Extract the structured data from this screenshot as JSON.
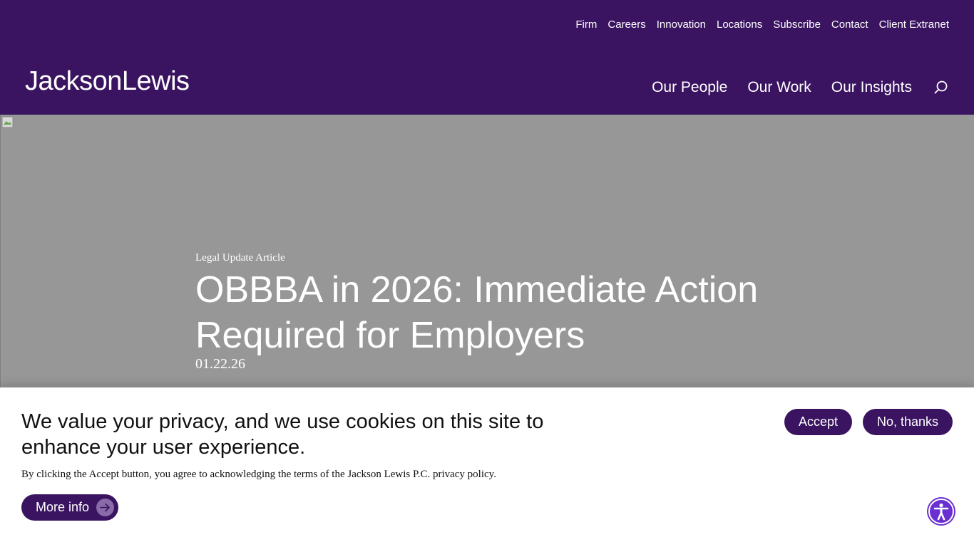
{
  "util_nav": [
    "Firm",
    "Careers",
    "Innovation",
    "Locations",
    "Subscribe",
    "Contact",
    "Client Extranet"
  ],
  "logo": "JacksonLewis",
  "main_nav": [
    "Our People",
    "Our Work",
    "Our Insights"
  ],
  "hero": {
    "kicker": "Legal Update Article",
    "title": "OBBBA in 2026: Immediate Action Required for Employers",
    "date": "01.22.26"
  },
  "cookie": {
    "heading": "We value your privacy, and we use cookies on this site to enhance your user experience.",
    "text": "By clicking the Accept button, you agree to acknowledging the terms of the Jackson Lewis P.C. privacy policy.",
    "accept": "Accept",
    "decline": "No, thanks",
    "more": "More info"
  },
  "icons": {
    "search": "search-icon",
    "arrow": "arrow-right-icon",
    "accessibility": "accessibility-icon"
  },
  "colors": {
    "brand_purple": "#3a1460",
    "hero_gray": "#979797",
    "a11y_purple": "#6a2fd0"
  }
}
